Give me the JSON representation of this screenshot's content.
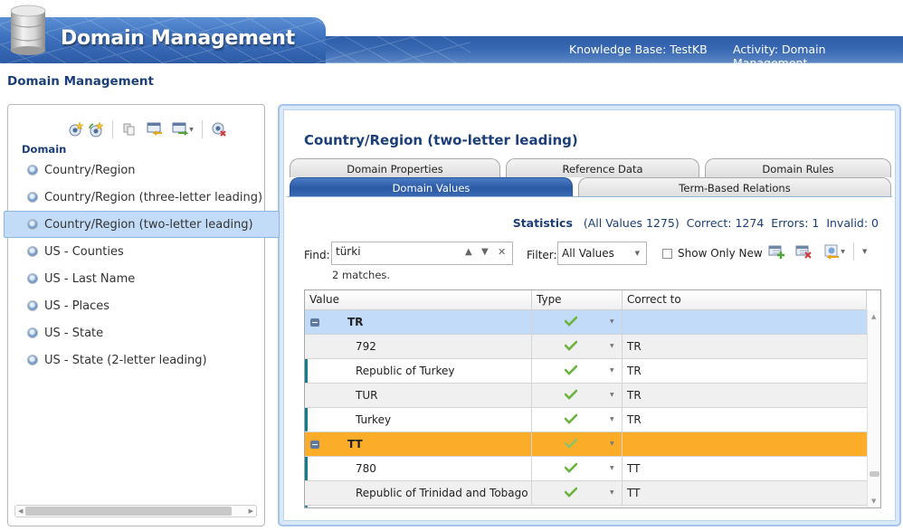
{
  "header": {
    "app_title": "Domain Management",
    "knowledge_base": "Knowledge Base: TestKB",
    "activity": "Activity: Domain Management"
  },
  "page_title": "Domain Management",
  "left_panel": {
    "toolbar_icons": [
      "create-domain-icon",
      "create-composite-domain-icon",
      "copy-domain-icon",
      "import-domain-icon",
      "export-domain-icon",
      "delete-domain-icon"
    ],
    "domain_header": "Domain",
    "domains": [
      {
        "label": "Country/Region",
        "selected": false
      },
      {
        "label": "Country/Region (three-letter leading)",
        "selected": false
      },
      {
        "label": "Country/Region (two-letter leading)",
        "selected": true
      },
      {
        "label": "US - Counties",
        "selected": false
      },
      {
        "label": "US - Last Name",
        "selected": false
      },
      {
        "label": "US - Places",
        "selected": false
      },
      {
        "label": "US - State",
        "selected": false
      },
      {
        "label": "US - State (2-letter leading)",
        "selected": false
      }
    ]
  },
  "right_panel": {
    "domain_heading": "Country/Region (two-letter leading)",
    "tabs_top": [
      "Domain Properties",
      "Reference Data",
      "Domain Rules"
    ],
    "tabs_bottom": [
      "Domain Values",
      "Term-Based Relations"
    ],
    "active_tab": "Domain Values",
    "statistics": {
      "label": "Statistics",
      "all_values": "(All Values 1275)",
      "correct": "Correct: 1274",
      "errors": "Errors: 1",
      "invalid": "Invalid: 0"
    },
    "find": {
      "label": "Find:",
      "value": "türki",
      "matches": "2 matches."
    },
    "filter": {
      "label": "Filter:",
      "selected": "All Values"
    },
    "show_only_new": {
      "label": "Show Only New",
      "checked": false
    },
    "grid": {
      "columns": [
        "Value",
        "Type",
        "Correct to"
      ],
      "rows": [
        {
          "value": "TR",
          "type": "correct",
          "correct_to": "",
          "kind": "group",
          "state": "selected"
        },
        {
          "value": "792",
          "type": "correct",
          "correct_to": "TR",
          "kind": "child"
        },
        {
          "value": "Republic of Turkey",
          "type": "correct",
          "correct_to": "TR",
          "kind": "child"
        },
        {
          "value": "TUR",
          "type": "correct",
          "correct_to": "TR",
          "kind": "child"
        },
        {
          "value": "Turkey",
          "type": "correct",
          "correct_to": "TR",
          "kind": "child"
        },
        {
          "value": "TT",
          "type": "correct",
          "correct_to": "",
          "kind": "group",
          "state": "highlighted"
        },
        {
          "value": "780",
          "type": "correct",
          "correct_to": "TT",
          "kind": "child"
        },
        {
          "value": "Republic of Trinidad and Tobago",
          "type": "correct",
          "correct_to": "TT",
          "kind": "child"
        }
      ]
    }
  },
  "colors": {
    "banner_blue": "#2f5ea8",
    "heading_navy": "#1c3f7a",
    "selected_row": "#c1dbf9",
    "highlight_row": "#fbad2a",
    "group_bar_teal": "#137c8f",
    "active_tab": "#2b59a3"
  }
}
